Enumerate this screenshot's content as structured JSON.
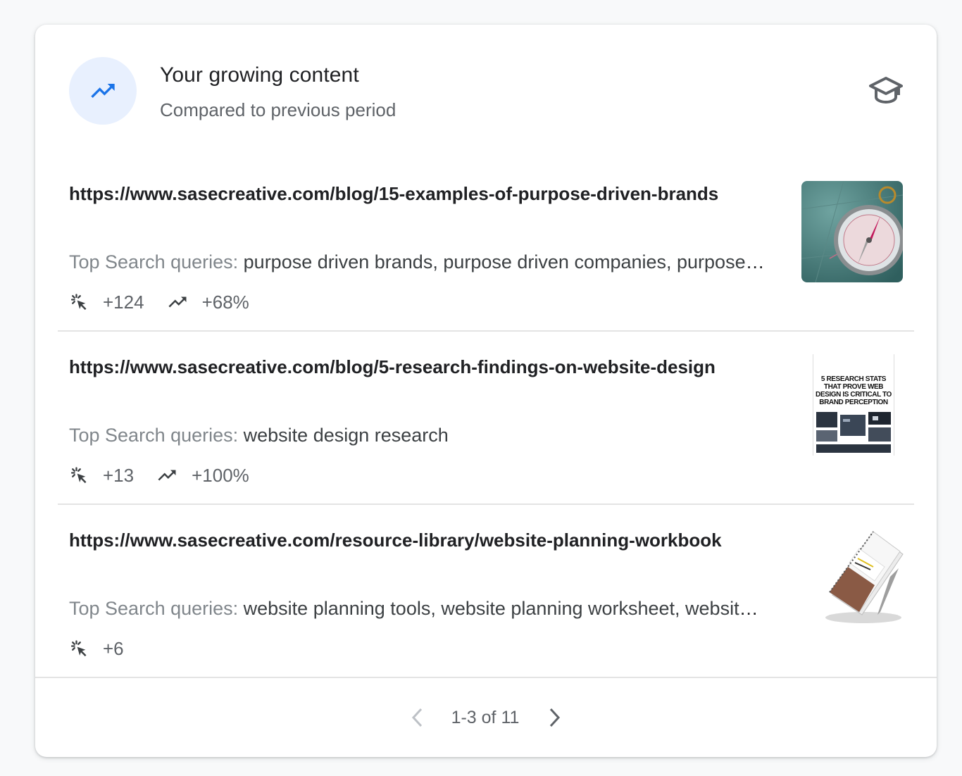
{
  "header": {
    "title": "Your growing content",
    "subtitle": "Compared to previous period",
    "trend_icon": "trending-up-icon",
    "learn_icon": "school-icon",
    "accent_color": "#1a73e8"
  },
  "items": [
    {
      "url": "https://www.sasecreative.com/blog/15-examples-of-purpose-driven-brands",
      "queries_label": "Top Search queries:",
      "queries": "purpose driven brands, purpose driven companies, purpose driven brands examples",
      "clicks": "+124",
      "growth": "+68%"
    },
    {
      "url": "https://www.sasecreative.com/blog/5-research-findings-on-website-design",
      "queries_label": "Top Search queries:",
      "queries": "website design research",
      "clicks": "+13",
      "growth": "+100%",
      "thumb_lines": [
        "5 RESEARCH STATS",
        "THAT PROVE WEB",
        "DESIGN IS CRITICAL TO",
        "BRAND PERCEPTION"
      ]
    },
    {
      "url": "https://www.sasecreative.com/resource-library/website-planning-workbook",
      "queries_label": "Top Search queries:",
      "queries": "website planning tools, website planning worksheet, website planning template",
      "clicks": "+6"
    }
  ],
  "pagination": {
    "range": "1-3 of 11"
  }
}
